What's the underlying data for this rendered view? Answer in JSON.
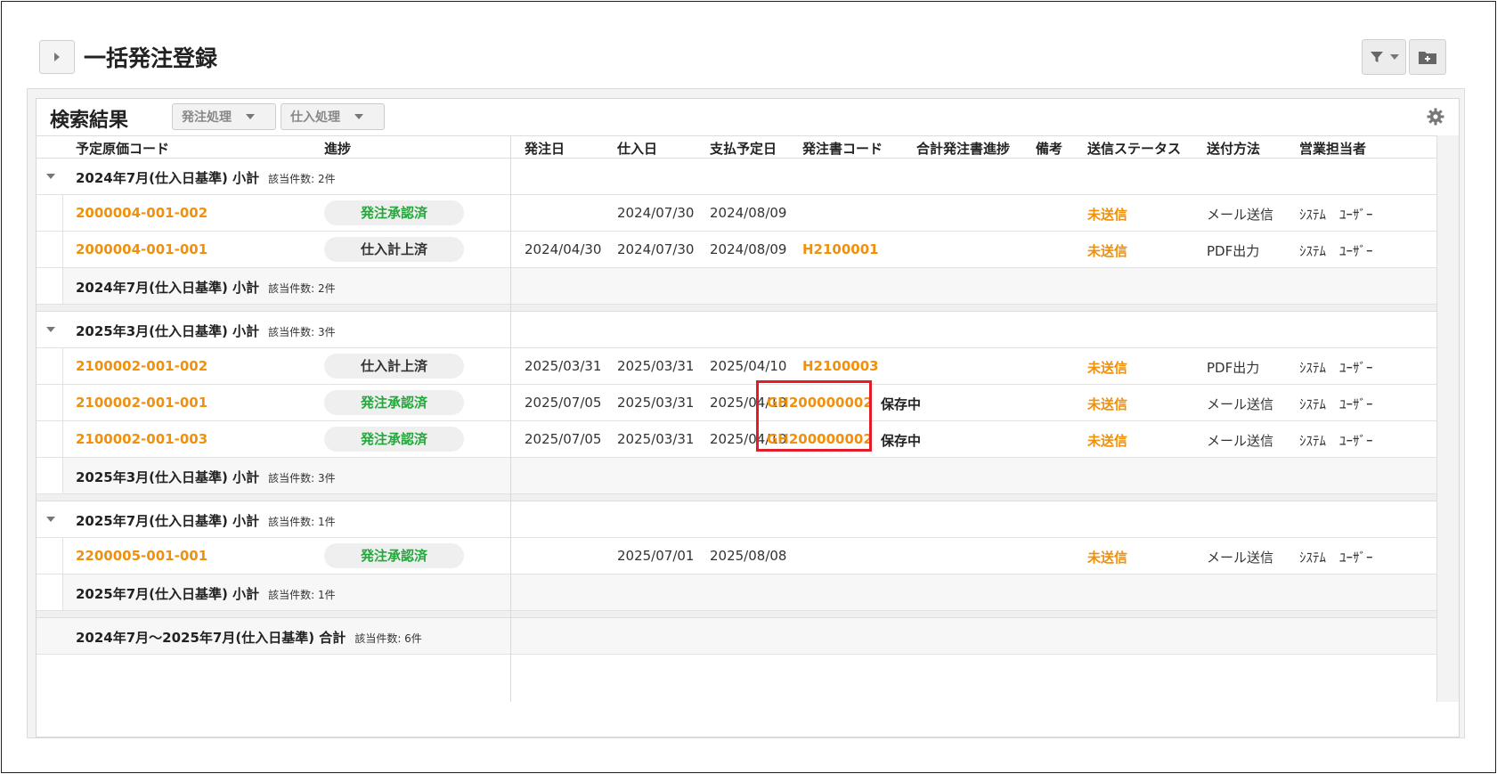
{
  "header": {
    "title": "一括発注登録"
  },
  "panel": {
    "title": "検索結果",
    "buttons": [
      {
        "label": "発注処理"
      },
      {
        "label": "仕入処理"
      }
    ]
  },
  "columns": [
    "予定原価コード",
    "進捗",
    "発注日",
    "仕入日",
    "支払予定日",
    "発注書コード",
    "合計発注書進捗",
    "備考",
    "送信ステータス",
    "送付方法",
    "営業担当者"
  ],
  "groups": [
    {
      "label": "2024年7月(仕入日基準) 小計",
      "count": "該当件数: 2件",
      "rows": [
        {
          "code": "2000004-001-002",
          "progress": "発注承認済",
          "progress_color": "green",
          "order_date": "",
          "purchase_date": "2024/07/30",
          "pay_date": "2024/08/09",
          "po_code": "",
          "total_progress": "",
          "note": "",
          "send_status": "未送信",
          "method": "メール送信",
          "staff": "ｼｽﾃﾑ　ﾕｰｻﾞｰ"
        },
        {
          "code": "2000004-001-001",
          "progress": "仕入計上済",
          "progress_color": "dark",
          "order_date": "2024/04/30",
          "purchase_date": "2024/07/30",
          "pay_date": "2024/08/09",
          "po_code": "H2100001",
          "total_progress": "",
          "note": "",
          "send_status": "未送信",
          "method": "PDF出力",
          "staff": "ｼｽﾃﾑ　ﾕｰｻﾞｰ"
        }
      ]
    },
    {
      "label": "2025年3月(仕入日基準) 小計",
      "count": "該当件数: 3件",
      "rows": [
        {
          "code": "2100002-001-002",
          "progress": "仕入計上済",
          "progress_color": "dark",
          "order_date": "2025/03/31",
          "purchase_date": "2025/03/31",
          "pay_date": "2025/04/10",
          "po_code": "H2100003",
          "total_progress": "",
          "note": "",
          "send_status": "未送信",
          "method": "PDF出力",
          "staff": "ｼｽﾃﾑ　ﾕｰｻﾞｰ"
        },
        {
          "code": "2100002-001-001",
          "progress": "発注承認済",
          "progress_color": "green",
          "order_date": "2025/07/05",
          "purchase_date": "2025/03/31",
          "pay_date": "2025/04/10",
          "po_code": "GH200000002",
          "total_progress": "保存中",
          "note": "",
          "send_status": "未送信",
          "method": "メール送信",
          "staff": "ｼｽﾃﾑ　ﾕｰｻﾞｰ"
        },
        {
          "code": "2100002-001-003",
          "progress": "発注承認済",
          "progress_color": "green",
          "order_date": "2025/07/05",
          "purchase_date": "2025/03/31",
          "pay_date": "2025/04/10",
          "po_code": "GH200000002",
          "total_progress": "保存中",
          "note": "",
          "send_status": "未送信",
          "method": "メール送信",
          "staff": "ｼｽﾃﾑ　ﾕｰｻﾞｰ"
        }
      ]
    },
    {
      "label": "2025年7月(仕入日基準) 小計",
      "count": "該当件数: 1件",
      "rows": [
        {
          "code": "2200005-001-001",
          "progress": "発注承認済",
          "progress_color": "green",
          "order_date": "",
          "purchase_date": "2025/07/01",
          "pay_date": "2025/08/08",
          "po_code": "",
          "total_progress": "",
          "note": "",
          "send_status": "未送信",
          "method": "メール送信",
          "staff": "ｼｽﾃﾑ　ﾕｰｻﾞｰ"
        }
      ]
    }
  ],
  "total": {
    "label": "2024年7月～2025年7月(仕入日基準) 合計",
    "count": "該当件数: 6件"
  }
}
